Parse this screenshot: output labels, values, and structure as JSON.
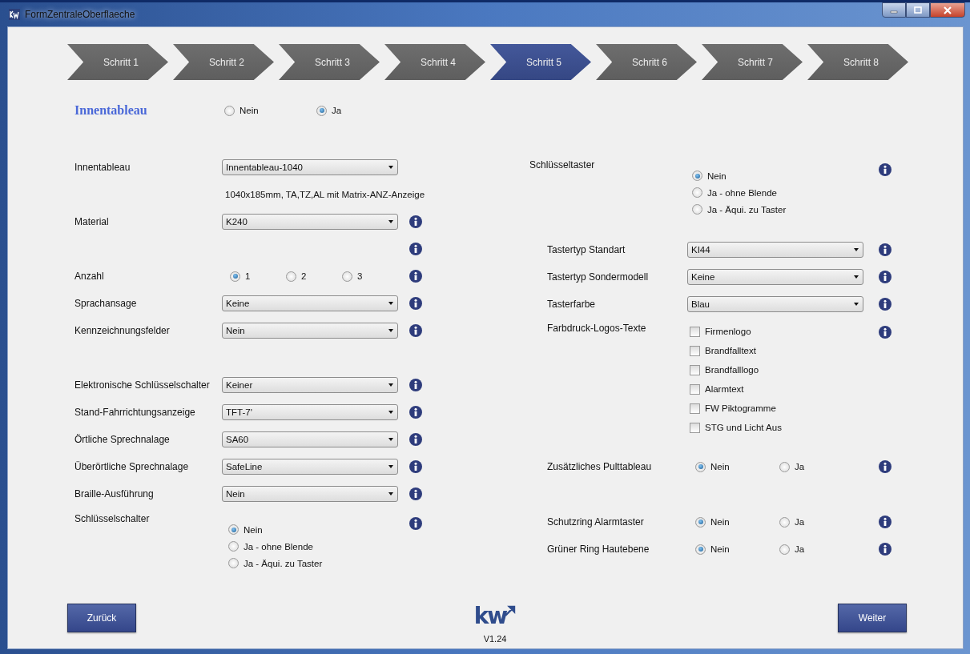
{
  "window": {
    "title": "FormZentraleOberflaeche"
  },
  "steps": [
    {
      "label": "Schritt 1",
      "selected": false
    },
    {
      "label": "Schritt 2",
      "selected": false
    },
    {
      "label": "Schritt 3",
      "selected": false
    },
    {
      "label": "Schritt 4",
      "selected": false
    },
    {
      "label": "Schritt 5",
      "selected": true
    },
    {
      "label": "Schritt 6",
      "selected": false
    },
    {
      "label": "Schritt 7",
      "selected": false
    },
    {
      "label": "Schritt 8",
      "selected": false
    }
  ],
  "section": {
    "title": "Innentableau",
    "options": [
      {
        "label": "Nein",
        "selected": false
      },
      {
        "label": "Ja",
        "selected": true
      }
    ]
  },
  "left_rows": [
    {
      "kind": "select",
      "label": "Innentableau",
      "value": "Innentableau-1040",
      "info": false
    },
    {
      "kind": "text",
      "text": "1040x185mm, TA,TZ,AL mit Matrix-ANZ-Anzeige",
      "info": false
    },
    {
      "kind": "select",
      "label": "Material",
      "value": "K240",
      "info": true
    },
    {
      "kind": "info",
      "info": true
    },
    {
      "kind": "radio_inline",
      "label": "Anzahl",
      "options": [
        {
          "label": "1",
          "selected": true
        },
        {
          "label": "2",
          "selected": false
        },
        {
          "label": "3",
          "selected": false
        }
      ],
      "info": true
    },
    {
      "kind": "select",
      "label": "Sprachansage",
      "value": "Keine",
      "info": true
    },
    {
      "kind": "select",
      "label": "Kennzeichnungsfelder",
      "value": "Nein",
      "info": true
    },
    {
      "kind": "select",
      "label": "Elektronische Schlüsselschalter",
      "value": "Keiner",
      "info": true
    },
    {
      "kind": "select",
      "label": "Stand-Fahrrichtungsanzeige",
      "value": "TFT-7'",
      "info": true
    },
    {
      "kind": "select",
      "label": "Örtliche Sprechnalage",
      "value": "SA60",
      "info": true
    },
    {
      "kind": "select",
      "label": "Überörtliche Sprechnalage",
      "value": "SafeLine",
      "info": true
    },
    {
      "kind": "select",
      "label": "Braille-Ausführung",
      "value": "Nein",
      "info": true
    },
    {
      "kind": "radio_stack",
      "label": "Schlüsselschalter",
      "options": [
        {
          "label": "Nein",
          "selected": true
        },
        {
          "label": "Ja - ohne Blende",
          "selected": false
        },
        {
          "label": "Ja - Äqui. zu Taster",
          "selected": false
        }
      ],
      "info": true
    }
  ],
  "right_rows": [
    {
      "kind": "radio_stack",
      "label": "Schlüsseltaster",
      "options": [
        {
          "label": "Nein",
          "selected": true
        },
        {
          "label": "Ja - ohne Blende",
          "selected": false
        },
        {
          "label": "Ja - Äqui. zu Taster",
          "selected": false
        }
      ],
      "info": true
    },
    {
      "kind": "select",
      "label": "Tastertyp Standart",
      "value": "KI44",
      "info": true
    },
    {
      "kind": "select",
      "label": "Tastertyp Sondermodell",
      "value": "Keine",
      "info": true
    },
    {
      "kind": "select",
      "label": "Tasterfarbe",
      "value": "Blau",
      "info": true
    },
    {
      "kind": "checkbox_stack",
      "label": "Farbdruck-Logos-Texte",
      "options": [
        {
          "label": "Firmenlogo",
          "checked": false
        },
        {
          "label": "Brandfalltext",
          "checked": false
        },
        {
          "label": "Brandfalllogo",
          "checked": false
        },
        {
          "label": "Alarmtext",
          "checked": false
        },
        {
          "label": "FW Piktogramme",
          "checked": false
        },
        {
          "label": "STG und Licht Aus",
          "checked": false
        }
      ],
      "info": true
    },
    {
      "kind": "radio_inline",
      "label": "Zusätzliches Pulttableau",
      "options": [
        {
          "label": "Nein",
          "selected": true
        },
        {
          "label": "Ja",
          "selected": false
        }
      ],
      "info": true
    },
    {
      "kind": "radio_inline",
      "label": "Schutzring Alarmtaster",
      "options": [
        {
          "label": "Nein",
          "selected": true
        },
        {
          "label": "Ja",
          "selected": false
        }
      ],
      "info": true
    },
    {
      "kind": "radio_inline",
      "label": "Grüner Ring Hautebene",
      "options": [
        {
          "label": "Nein",
          "selected": true
        },
        {
          "label": "Ja",
          "selected": false
        }
      ],
      "info": true
    }
  ],
  "footer": {
    "back": "Zurück",
    "logo": "kw",
    "version": "V1.24",
    "next": "Weiter"
  }
}
